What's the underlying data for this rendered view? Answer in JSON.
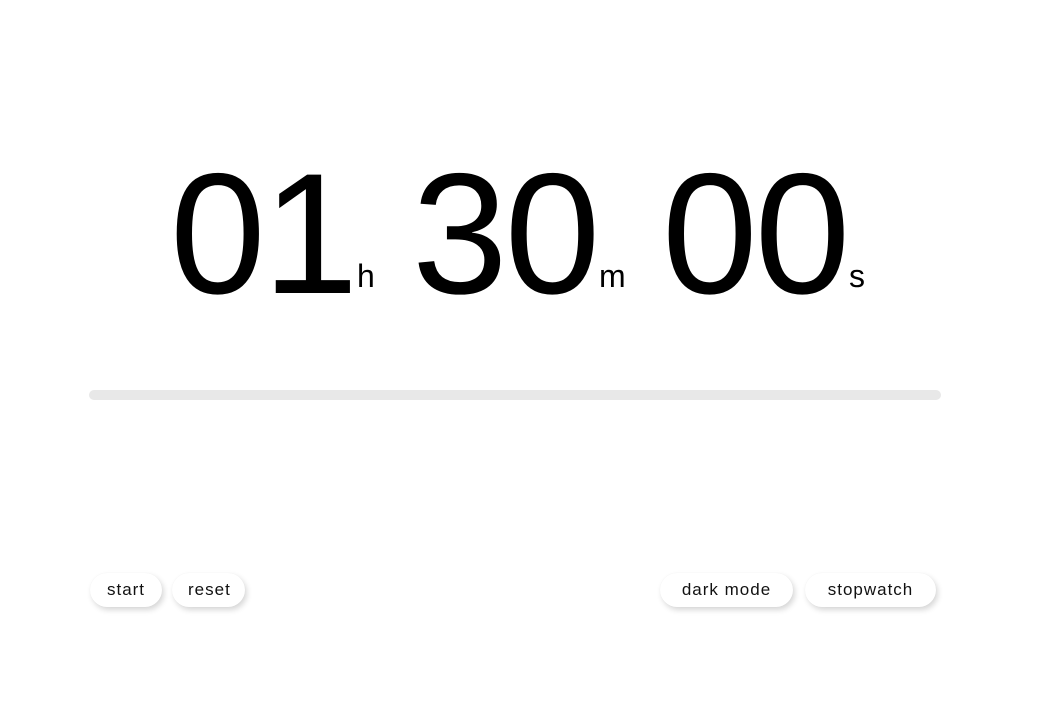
{
  "timer": {
    "hours": "01",
    "hours_unit": "h",
    "minutes": "30",
    "minutes_unit": "m",
    "seconds": "00",
    "seconds_unit": "s"
  },
  "progress": {
    "fraction": 0
  },
  "controls": {
    "start_label": "start",
    "reset_label": "reset",
    "dark_mode_label": "dark mode",
    "stopwatch_label": "stopwatch"
  },
  "colors": {
    "background": "#ffffff",
    "text": "#000000",
    "progress_track": "#e8e8e8"
  }
}
